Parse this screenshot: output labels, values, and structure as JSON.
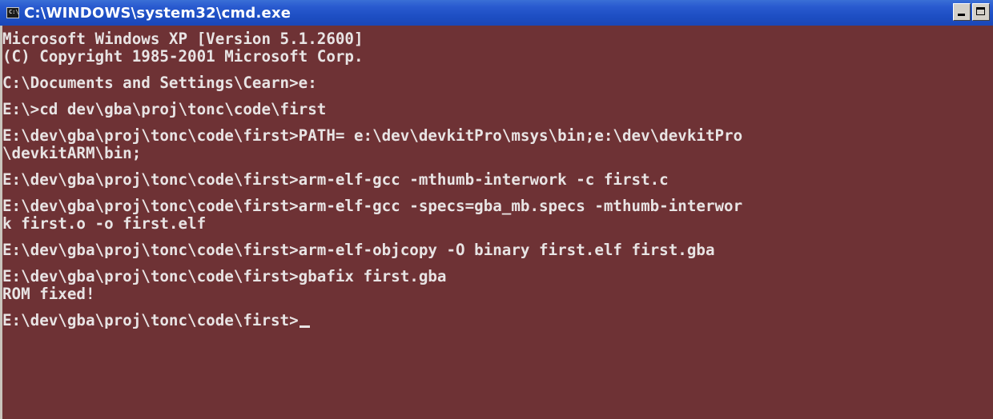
{
  "window": {
    "title": "C:\\WINDOWS\\system32\\cmd.exe",
    "icon": "cmd-icon",
    "icon_glyph": "C:\\",
    "background_color": "#6e3235",
    "text_color": "#e8e4e4"
  },
  "console": {
    "lines": [
      "Microsoft Windows XP [Version 5.1.2600]",
      "(C) Copyright 1985-2001 Microsoft Corp.",
      "",
      "C:\\Documents and Settings\\Cearn>e:",
      "",
      "E:\\>cd dev\\gba\\proj\\tonc\\code\\first",
      "",
      "E:\\dev\\gba\\proj\\tonc\\code\\first>PATH= e:\\dev\\devkitPro\\msys\\bin;e:\\dev\\devkitPro",
      "\\devkitARM\\bin;",
      "",
      "E:\\dev\\gba\\proj\\tonc\\code\\first>arm-elf-gcc -mthumb-interwork -c first.c",
      "",
      "E:\\dev\\gba\\proj\\tonc\\code\\first>arm-elf-gcc -specs=gba_mb.specs -mthumb-interwor",
      "k first.o -o first.elf",
      "",
      "E:\\dev\\gba\\proj\\tonc\\code\\first>arm-elf-objcopy -O binary first.elf first.gba",
      "",
      "E:\\dev\\gba\\proj\\tonc\\code\\first>gbafix first.gba",
      "ROM fixed!",
      "",
      "E:\\dev\\gba\\proj\\tonc\\code\\first>"
    ]
  }
}
